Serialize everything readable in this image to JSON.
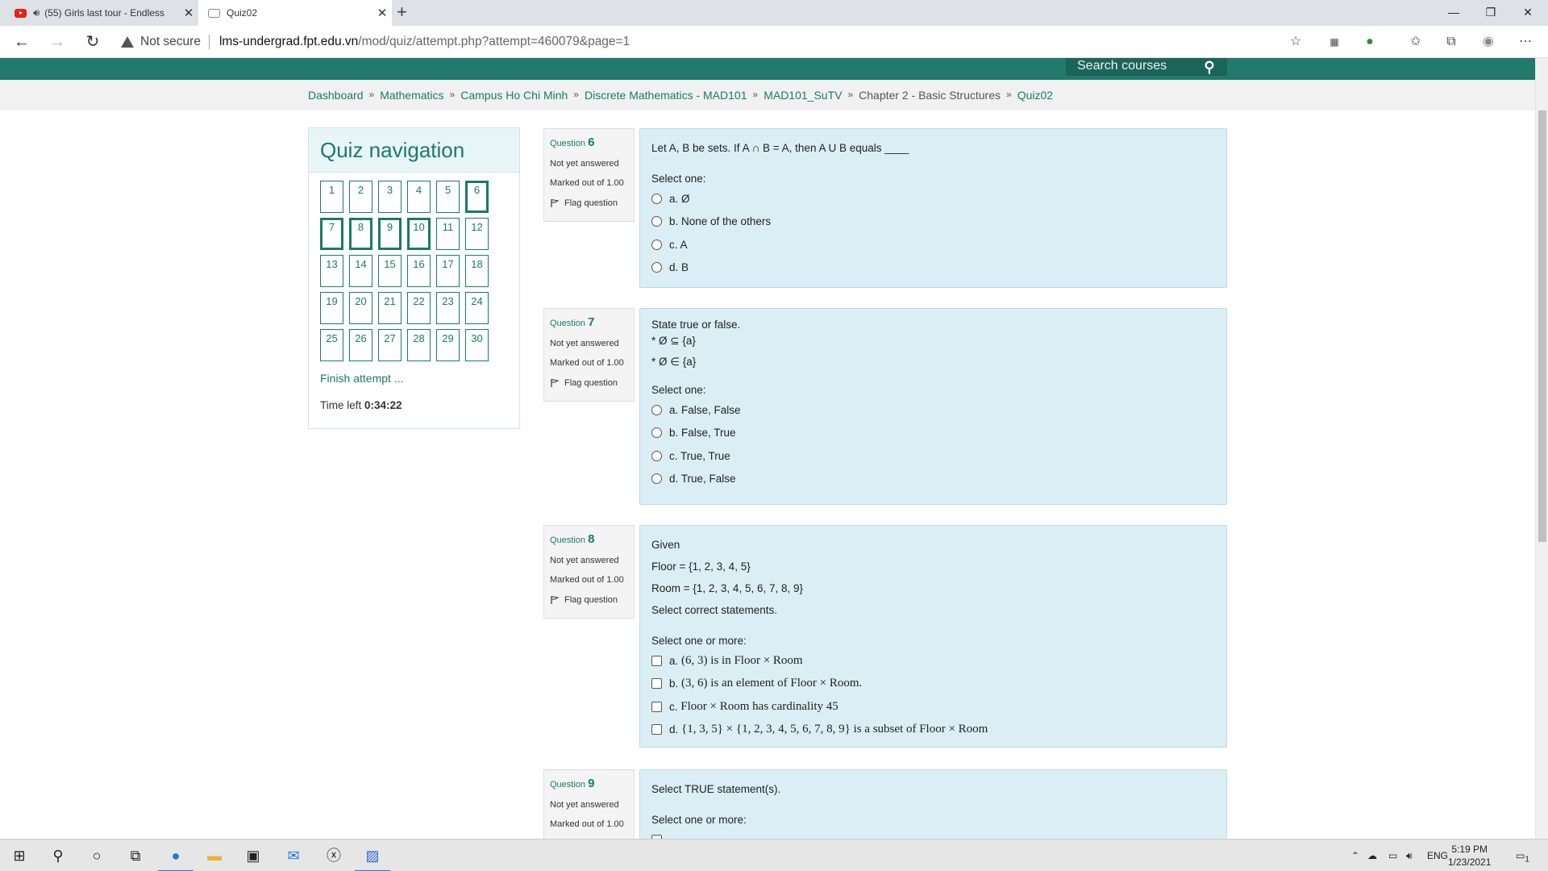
{
  "browser": {
    "tabs": [
      {
        "title": "(55) Girls last tour - Endless",
        "favicon": "youtube-icon",
        "audio": true
      },
      {
        "title": "Quiz02",
        "favicon": "page-icon"
      }
    ],
    "address": {
      "security": "Not secure",
      "host": "lms-undergrad.fpt.edu.vn",
      "path": "/mod/quiz/attempt.php?attempt=460079&page=1"
    }
  },
  "header": {
    "search_placeholder": "Search courses"
  },
  "breadcrumb": [
    {
      "label": "Dashboard",
      "link": true
    },
    {
      "label": "Mathematics",
      "link": true
    },
    {
      "label": "Campus Ho Chi Minh",
      "link": true
    },
    {
      "label": "Discrete Mathematics - MAD101",
      "link": true
    },
    {
      "label": "MAD101_SuTV",
      "link": true
    },
    {
      "label": "Chapter 2 - Basic Structures",
      "link": false
    },
    {
      "label": "Quiz02",
      "link": true
    }
  ],
  "quiz_nav": {
    "title": "Quiz navigation",
    "buttons": [
      "1",
      "2",
      "3",
      "4",
      "5",
      "6",
      "7",
      "8",
      "9",
      "10",
      "11",
      "12",
      "13",
      "14",
      "15",
      "16",
      "17",
      "18",
      "19",
      "20",
      "21",
      "22",
      "23",
      "24",
      "25",
      "26",
      "27",
      "28",
      "29",
      "30"
    ],
    "current_page": [
      "6",
      "7",
      "8",
      "9",
      "10"
    ],
    "finish": "Finish attempt ...",
    "time_label": "Time left",
    "time_value": "0:34:22"
  },
  "questions": [
    {
      "label": "Question",
      "number": "6",
      "state": "Not yet answered",
      "mark": "Marked out of 1.00",
      "flag": "Flag question",
      "text": [
        "Let A, B be sets. If A ∩ B = A, then A U B equals ____"
      ],
      "select": "Select one:",
      "type": "radio",
      "options": [
        "a. Ø",
        "b. None of the others",
        "c. A",
        "d. B"
      ]
    },
    {
      "label": "Question",
      "number": "7",
      "state": "Not yet answered",
      "mark": "Marked out of 1.00",
      "flag": "Flag question",
      "text": [
        "State true or false.",
        "* Ø ⊆ {a}",
        "* Ø ∈ {a}"
      ],
      "select": "Select one:",
      "type": "radio",
      "options": [
        "a. False, False",
        "b. False, True",
        "c. True, True",
        "d. True, False"
      ]
    },
    {
      "label": "Question",
      "number": "8",
      "state": "Not yet answered",
      "mark": "Marked out of 1.00",
      "flag": "Flag question",
      "text": [
        "Given",
        "Floor = {1, 2, 3, 4, 5}",
        "Room = {1, 2, 3, 4, 5, 6, 7, 8, 9}",
        "Select correct statements."
      ],
      "select": "Select one or more:",
      "type": "checkbox",
      "options": [
        {
          "letter": "a.",
          "text": "(6, 3) is in Floor × Room"
        },
        {
          "letter": "b.",
          "text": "(3, 6) is an element of Floor × Room."
        },
        {
          "letter": "c.",
          "text": "Floor × Room has cardinality 45"
        },
        {
          "letter": "d.",
          "text": "{1, 3, 5} × {1, 2, 3, 4, 5, 6, 7, 8, 9} is a subset of Floor × Room"
        }
      ]
    },
    {
      "label": "Question",
      "number": "9",
      "state": "Not yet answered",
      "mark": "Marked out of 1.00",
      "text": [
        "Select TRUE statement(s)."
      ],
      "select": "Select one or more:"
    }
  ],
  "taskbar": {
    "lang": "ENG",
    "time": "5:19 PM",
    "date": "1/23/2021",
    "notifications": "1"
  }
}
